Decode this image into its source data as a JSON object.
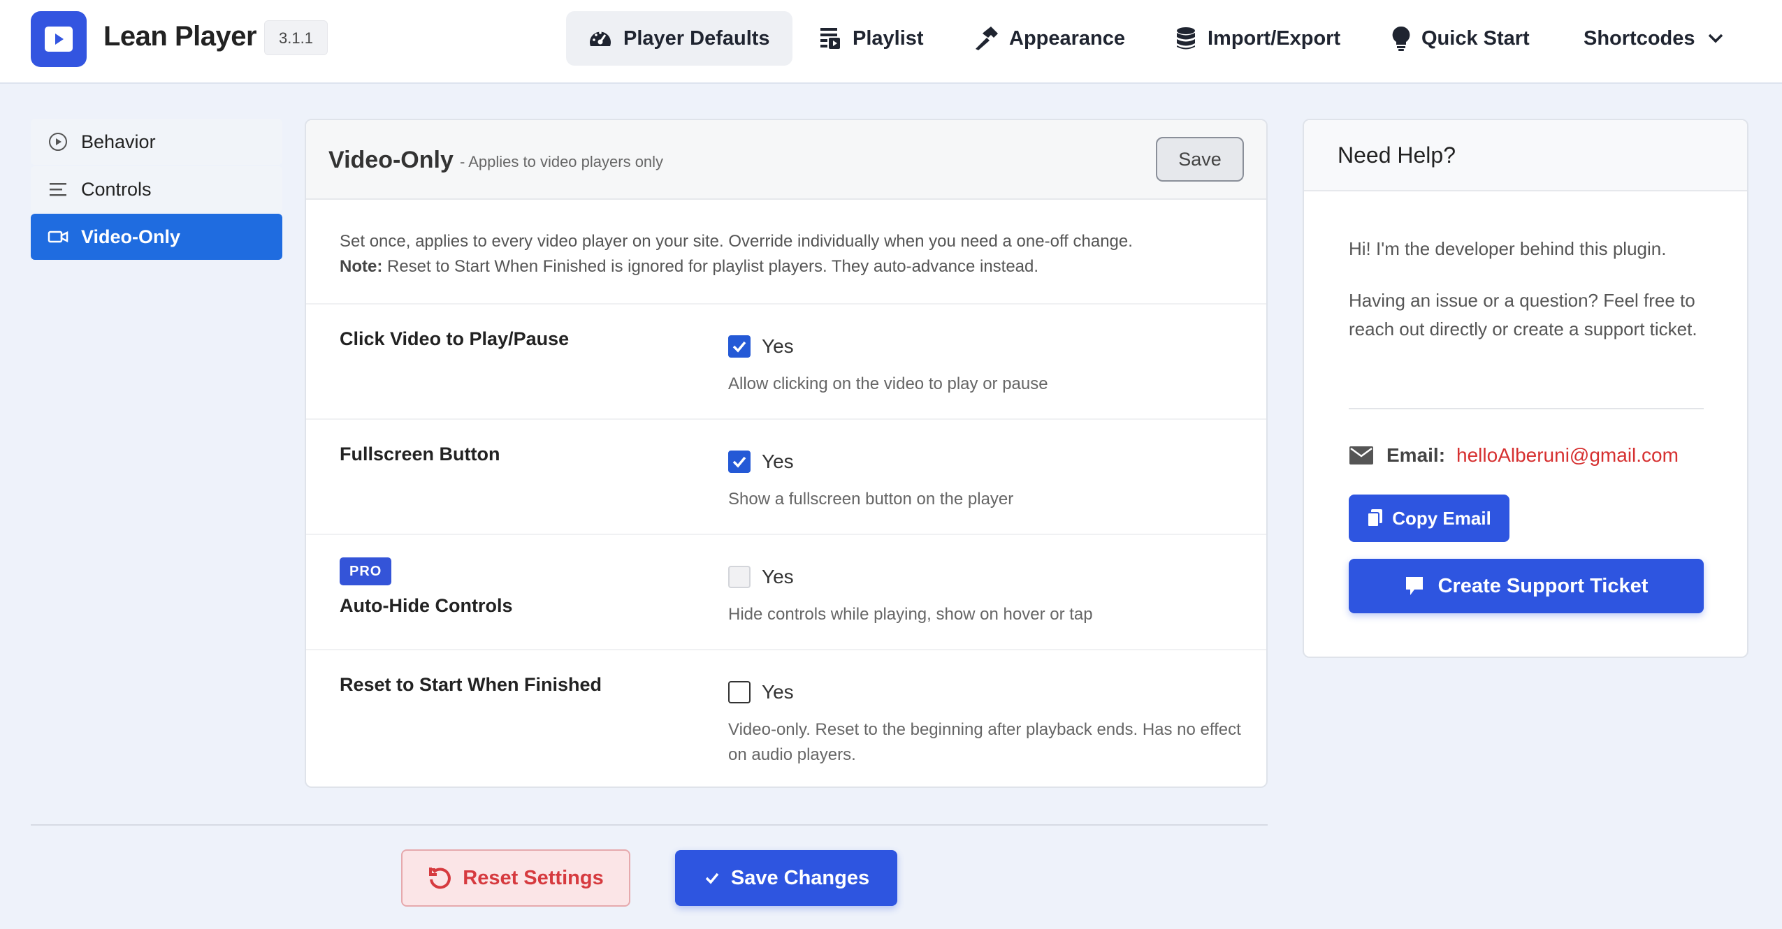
{
  "app": {
    "name": "Lean Player",
    "version": "3.1.1",
    "accent": "#3355e0"
  },
  "nav": {
    "items": [
      {
        "label": "Player Defaults",
        "icon": "gauge-icon",
        "active": true
      },
      {
        "label": "Playlist",
        "icon": "playlist-icon"
      },
      {
        "label": "Appearance",
        "icon": "hammer-icon"
      },
      {
        "label": "Import/Export",
        "icon": "database-icon"
      },
      {
        "label": "Quick Start",
        "icon": "lightbulb-icon"
      },
      {
        "label": "Shortcodes",
        "icon": "chevron-down-icon"
      }
    ]
  },
  "sidebar": {
    "items": [
      {
        "label": "Behavior",
        "icon": "play-circle-icon"
      },
      {
        "label": "Controls",
        "icon": "lines-icon"
      },
      {
        "label": "Video-Only",
        "icon": "video-camera-icon",
        "active": true
      }
    ]
  },
  "card": {
    "title": "Video-Only",
    "subtitle": "- Applies to video players only",
    "save_label": "Save",
    "intro_line1": "Set once, applies to every video player on your site. Override individually when you need a one-off change.",
    "intro_note_label": "Note:",
    "intro_note_text": "Reset to Start When Finished is ignored for playlist players. They auto-advance instead.",
    "rows": [
      {
        "label": "Click Video to Play/Pause",
        "checked": true,
        "option": "Yes",
        "help": "Allow clicking on the video to play or pause"
      },
      {
        "label": "Fullscreen Button",
        "checked": true,
        "option": "Yes",
        "help": "Show a fullscreen button on the player"
      },
      {
        "label": "Auto-Hide Controls",
        "badge": "PRO",
        "checked": false,
        "disabled": true,
        "option": "Yes",
        "help": "Hide controls while playing, show on hover or tap"
      },
      {
        "label": "Reset to Start When Finished",
        "checked": false,
        "option": "Yes",
        "help": "Video-only. Reset to the beginning after playback ends. Has no effect on audio players."
      }
    ]
  },
  "footer": {
    "reset_label": "Reset Settings",
    "save_label": "Save Changes"
  },
  "help": {
    "title": "Need Help?",
    "intro": "Hi! I'm the developer behind this plugin.",
    "body": "Having an issue or a question? Feel free to reach out directly or create a support ticket.",
    "email_label": "Email:",
    "email": "helloAlberuni@gmail.com",
    "copy_label": "Copy Email",
    "ticket_label": "Create Support Ticket"
  },
  "colors": {
    "primary": "#2e55e0",
    "active_sidebar": "#1f6ce0",
    "danger": "#d63a3f",
    "email": "#d63030"
  }
}
